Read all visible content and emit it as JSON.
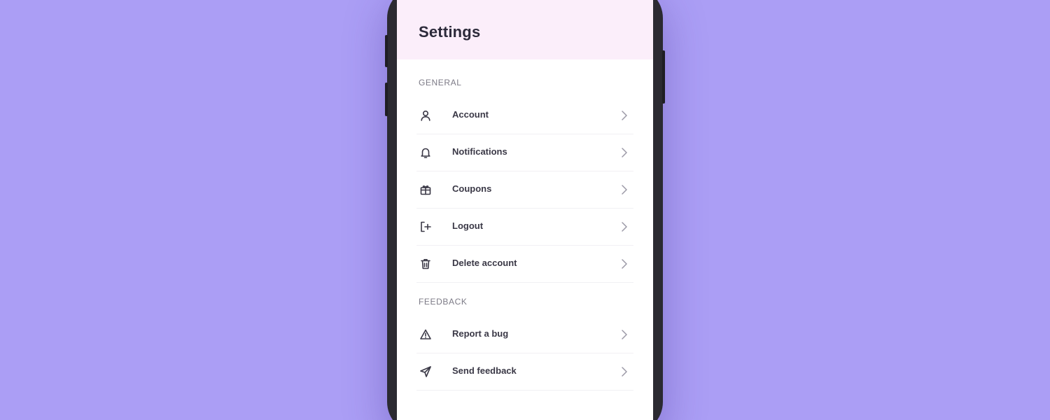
{
  "colors": {
    "background": "#ab9ef5",
    "header_bg": "#fbeefa",
    "screen_bg": "#ffffff",
    "phone_frame": "#2b2a31",
    "text_primary": "#2c2a3a",
    "text_muted": "#7c7a86"
  },
  "header": {
    "title": "Settings"
  },
  "sections": [
    {
      "label": "GENERAL",
      "items": [
        {
          "label": "Account",
          "icon": "user-icon"
        },
        {
          "label": "Notifications",
          "icon": "bell-icon"
        },
        {
          "label": "Coupons",
          "icon": "gift-icon"
        },
        {
          "label": "Logout",
          "icon": "logout-icon"
        },
        {
          "label": "Delete account",
          "icon": "trash-icon"
        }
      ]
    },
    {
      "label": "FEEDBACK",
      "items": [
        {
          "label": "Report a bug",
          "icon": "warning-icon"
        },
        {
          "label": "Send feedback",
          "icon": "send-icon"
        }
      ]
    }
  ]
}
